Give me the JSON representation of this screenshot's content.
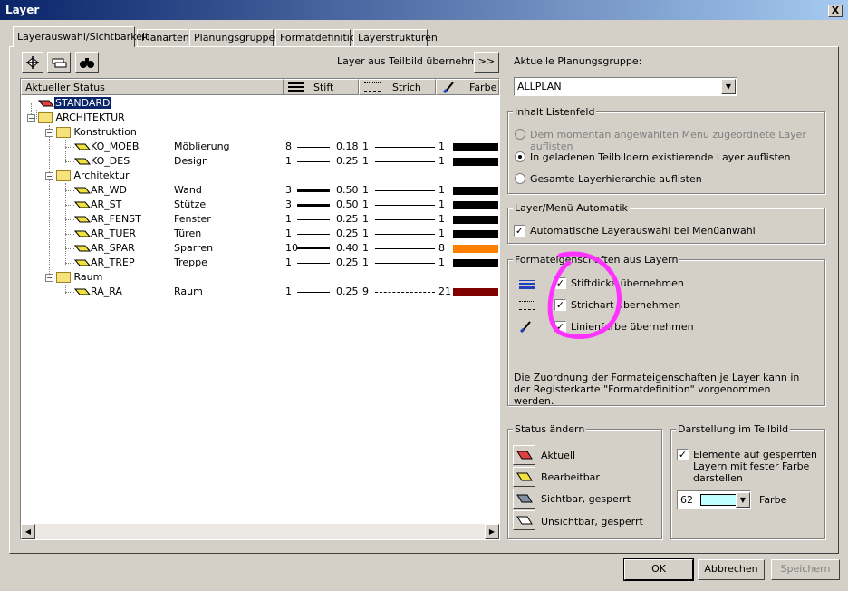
{
  "window": {
    "title": "Layer",
    "close_glyph": "X"
  },
  "tabs": [
    "Layerauswahl/Sichtbarkeit",
    "Planarten",
    "Planungsgruppen",
    "Formatdefinition",
    "Layerstrukturen"
  ],
  "toolbar": {
    "transfer_label": "Layer aus Teilbild übernehmen",
    "more_glyph": ">>"
  },
  "columns": {
    "status": "Aktueller Status",
    "stift": "Stift",
    "strich": "Strich",
    "farbe": "Farbe"
  },
  "tree": {
    "standard": "STANDARD",
    "architektur": "ARCHITEKTUR",
    "konstruktion": "Konstruktion",
    "architektur_sub": "Architektur",
    "raum": "Raum",
    "layers": [
      {
        "code": "KO_MOEB",
        "desc": "Möblierung",
        "pen": "8",
        "pen_val": "0.18",
        "line": "1",
        "line_end": "1",
        "color": "#000000"
      },
      {
        "code": "KO_DES",
        "desc": "Design",
        "pen": "1",
        "pen_val": "0.25",
        "line": "1",
        "line_end": "1",
        "color": "#000000"
      },
      {
        "code": "AR_WD",
        "desc": "Wand",
        "pen": "3",
        "pen_val": "0.50",
        "line": "1",
        "line_end": "1",
        "color": "#000000"
      },
      {
        "code": "AR_ST",
        "desc": "Stütze",
        "pen": "3",
        "pen_val": "0.50",
        "line": "1",
        "line_end": "1",
        "color": "#000000"
      },
      {
        "code": "AR_FENST",
        "desc": "Fenster",
        "pen": "1",
        "pen_val": "0.25",
        "line": "1",
        "line_end": "1",
        "color": "#000000"
      },
      {
        "code": "AR_TUER",
        "desc": "Türen",
        "pen": "1",
        "pen_val": "0.25",
        "line": "1",
        "line_end": "1",
        "color": "#000000"
      },
      {
        "code": "AR_SPAR",
        "desc": "Sparren",
        "pen": "10",
        "pen_val": "0.40",
        "line": "1",
        "line_end": "8",
        "color": "#ff8000"
      },
      {
        "code": "AR_TREP",
        "desc": "Treppe",
        "pen": "1",
        "pen_val": "0.25",
        "line": "1",
        "line_end": "1",
        "color": "#000000"
      },
      {
        "code": "RA_RA",
        "desc": "Raum",
        "pen": "1",
        "pen_val": "0.25",
        "line": "9",
        "line_end": "21",
        "color": "#800000"
      }
    ]
  },
  "planning": {
    "label": "Aktuelle Planungsgruppe:",
    "value": "ALLPLAN"
  },
  "inhalt": {
    "title": "Inhalt Listenfeld",
    "options": [
      "Dem momentan angewählten Menü zugeordnete Layer auflisten",
      "In geladenen Teilbildern existierende Layer auflisten",
      "Gesamte Layerhierarchie auflisten"
    ]
  },
  "automatik": {
    "title": "Layer/Menü Automatik",
    "checkbox": "Automatische Layerauswahl bei Menüanwahl"
  },
  "format": {
    "title": "Formateigenschaften aus Layern",
    "items": [
      "Stiftdicke übernehmen",
      "Strichart übernehmen",
      "Linienfarbe übernehmen"
    ],
    "note": "Die Zuordnung der Formateigenschaften je Layer kann in der Registerkarte \"Formatdefinition\" vorgenommen werden."
  },
  "status": {
    "title": "Status ändern",
    "items": [
      "Aktuell",
      "Bearbeitbar",
      "Sichtbar, gesperrt",
      "Unsichtbar, gesperrt"
    ]
  },
  "darstellung": {
    "title": "Darstellung im Teilbild",
    "checkbox": "Elemente auf gesperrten Layern mit fester Farbe darstellen",
    "color_num": "62",
    "farbe_label": "Farbe",
    "color": "#c0ffff"
  },
  "buttons": {
    "ok": "OK",
    "cancel": "Abbrechen",
    "save": "Speichern"
  },
  "check_glyph": "✓",
  "colors": {
    "titlebar": "#0a246a",
    "selection": "#0a246a",
    "annotation": "#ff33ff"
  }
}
